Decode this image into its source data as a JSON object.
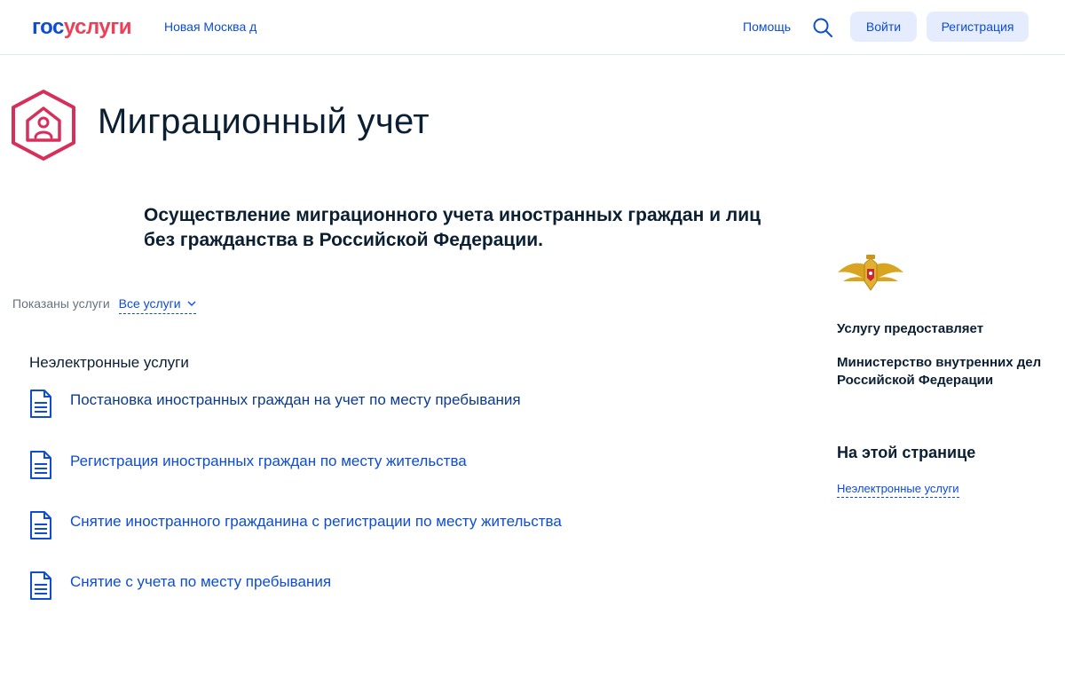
{
  "header": {
    "logo_part1": "гос",
    "logo_part2": "услуги",
    "location": "Новая Москва д",
    "help": "Помощь",
    "login": "Войти",
    "register": "Регистрация"
  },
  "page": {
    "title": "Миграционный учет",
    "description": "Осуществление миграционного учета иностранных граждан и лиц без гражданства в Российской Федерации."
  },
  "filter": {
    "label": "Показаны услуги",
    "selected": "Все услуги"
  },
  "services": {
    "section_title": "Неэлектронные услуги",
    "items": [
      {
        "label": "Постановка иностранных граждан на учет по месту пребывания"
      },
      {
        "label": "Регистрация иностранных граждан по месту жительства"
      },
      {
        "label": "Снятие иностранного гражданина с регистрации по месту жительства"
      },
      {
        "label": "Снятие с учета по месту пребывания"
      }
    ]
  },
  "sidebar": {
    "provider_label": "Услугу предоставляет",
    "provider_name": "Министерство внутренних дел Российской Федерации",
    "toc_title": "На этой странице",
    "toc_link": "Неэлектронные услуги"
  },
  "colors": {
    "brand_blue": "#0d4cd3",
    "brand_red": "#ee3f58",
    "button_bg": "#e4ecfd",
    "icon_red": "#d72f5a",
    "text_dark": "#0b1f33",
    "gold": "#d9a520"
  },
  "icons": {
    "search": "search-icon",
    "chevron": "chevron-down-icon",
    "category": "home-person-hexagon-icon",
    "document": "document-icon",
    "emblem": "mvd-emblem-icon"
  }
}
